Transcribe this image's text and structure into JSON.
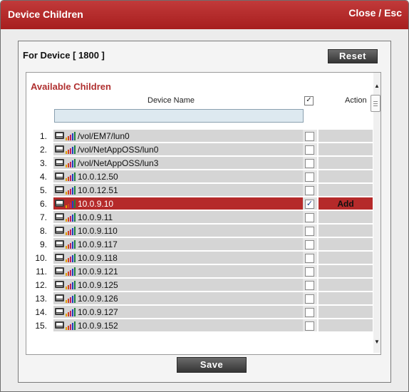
{
  "dialog": {
    "title": "Device Children",
    "close_label": "Close / Esc",
    "device_label": "For Device [ 1800 ]",
    "reset_label": "Reset",
    "save_label": "Save"
  },
  "list": {
    "section_title": "Available Children",
    "columns": {
      "device_name": "Device Name",
      "check": "✓",
      "action": "Action"
    },
    "filter_value": "",
    "rows": [
      {
        "num": "1.",
        "name": "/vol/EM7/lun0",
        "checked": false,
        "action": ""
      },
      {
        "num": "2.",
        "name": "/vol/NetAppOSS/lun0",
        "checked": false,
        "action": ""
      },
      {
        "num": "3.",
        "name": "/vol/NetAppOSS/lun3",
        "checked": false,
        "action": ""
      },
      {
        "num": "4.",
        "name": "10.0.12.50",
        "checked": false,
        "action": ""
      },
      {
        "num": "5.",
        "name": "10.0.12.51",
        "checked": false,
        "action": ""
      },
      {
        "num": "6.",
        "name": "10.0.9.10",
        "checked": true,
        "action": "Add",
        "selected": true
      },
      {
        "num": "7.",
        "name": "10.0.9.11",
        "checked": false,
        "action": ""
      },
      {
        "num": "8.",
        "name": "10.0.9.110",
        "checked": false,
        "action": ""
      },
      {
        "num": "9.",
        "name": "10.0.9.117",
        "checked": false,
        "action": ""
      },
      {
        "num": "10.",
        "name": "10.0.9.118",
        "checked": false,
        "action": ""
      },
      {
        "num": "11.",
        "name": "10.0.9.121",
        "checked": false,
        "action": ""
      },
      {
        "num": "12.",
        "name": "10.0.9.125",
        "checked": false,
        "action": ""
      },
      {
        "num": "13.",
        "name": "10.0.9.126",
        "checked": false,
        "action": ""
      },
      {
        "num": "14.",
        "name": "10.0.9.127",
        "checked": false,
        "action": ""
      },
      {
        "num": "15.",
        "name": "10.0.9.152",
        "checked": false,
        "action": ""
      }
    ]
  },
  "colors": {
    "titlebar": "#b72828",
    "selected_row": "#b52a2a",
    "section_title": "#b03030"
  },
  "icons": {
    "device": "device-icon",
    "signal": "signal-bars-icon"
  }
}
